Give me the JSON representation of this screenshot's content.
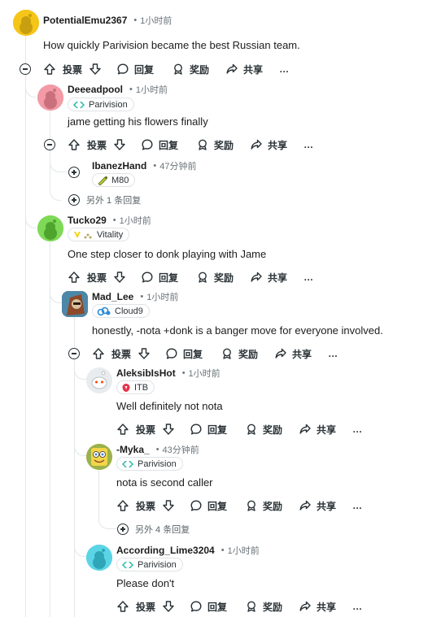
{
  "actions": {
    "upvote": "投票",
    "reply": "回复",
    "award": "奖励",
    "share": "共享",
    "more": "…"
  },
  "comments": [
    {
      "author": "PotentialEmu2367",
      "time": "1小时前",
      "body": "How quickly Parivision became the best Russian team.",
      "avatar_color": "#f5c518"
    },
    {
      "author": "Deeeadpool",
      "time": "1小时前",
      "flair": "Parivision",
      "body": "jame getting his flowers finally",
      "avatar_color": "#f29aa6"
    },
    {
      "author": "IbanezHand",
      "time": "47分钟前",
      "flair": "M80"
    },
    {
      "author": "Tucko29",
      "time": "1小时前",
      "flair": "Vitality",
      "body": "One step closer to donk playing with Jame",
      "avatar_color": "#7ed957"
    },
    {
      "author": "Mad_Lee",
      "time": "1小时前",
      "flair": "Cloud9",
      "body": "honestly, -nota +donk is a banger move for everyone involved."
    },
    {
      "author": "AleksibIsHot",
      "time": "1小时前",
      "flair": "ITB",
      "body": "Well definitely not nota"
    },
    {
      "author": "-Myka_",
      "time": "43分钟前",
      "flair": "Parivision",
      "body": "nota is second caller"
    },
    {
      "author": "According_Lime3204",
      "time": "1小时前",
      "flair": "Parivision",
      "body": "Please don't",
      "avatar_color": "#5bd5e6"
    }
  ],
  "more_replies": [
    "另外 1 条回复",
    "另外 4 条回复"
  ],
  "colors": {
    "accent_teal": "#1fb8a6",
    "thread_line": "#e2e7e9",
    "meta_gray": "#6b7479"
  }
}
